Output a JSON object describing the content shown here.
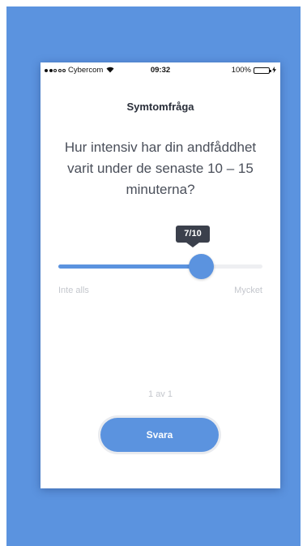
{
  "status_bar": {
    "carrier": "Cybercom",
    "time": "09:32",
    "battery": "100%",
    "signal_icon": "signal-dots-icon",
    "wifi_icon": "wifi-icon",
    "battery_icon": "battery-icon",
    "charging_icon": "bolt-icon"
  },
  "screen": {
    "title": "Symtomfråga",
    "question": "Hur intensiv har din andfåddhet varit under de senaste 10 – 15 minuterna?",
    "slider": {
      "value": 7,
      "max": 10,
      "tooltip": "7/10",
      "min_label": "Inte alls",
      "max_label": "Mycket"
    },
    "pager": "1 av 1",
    "submit_label": "Svara"
  },
  "colors": {
    "accent": "#5b93df",
    "background": "#5b93df",
    "tooltip_bg": "#3b404c",
    "muted_text": "#c4c7cd"
  }
}
